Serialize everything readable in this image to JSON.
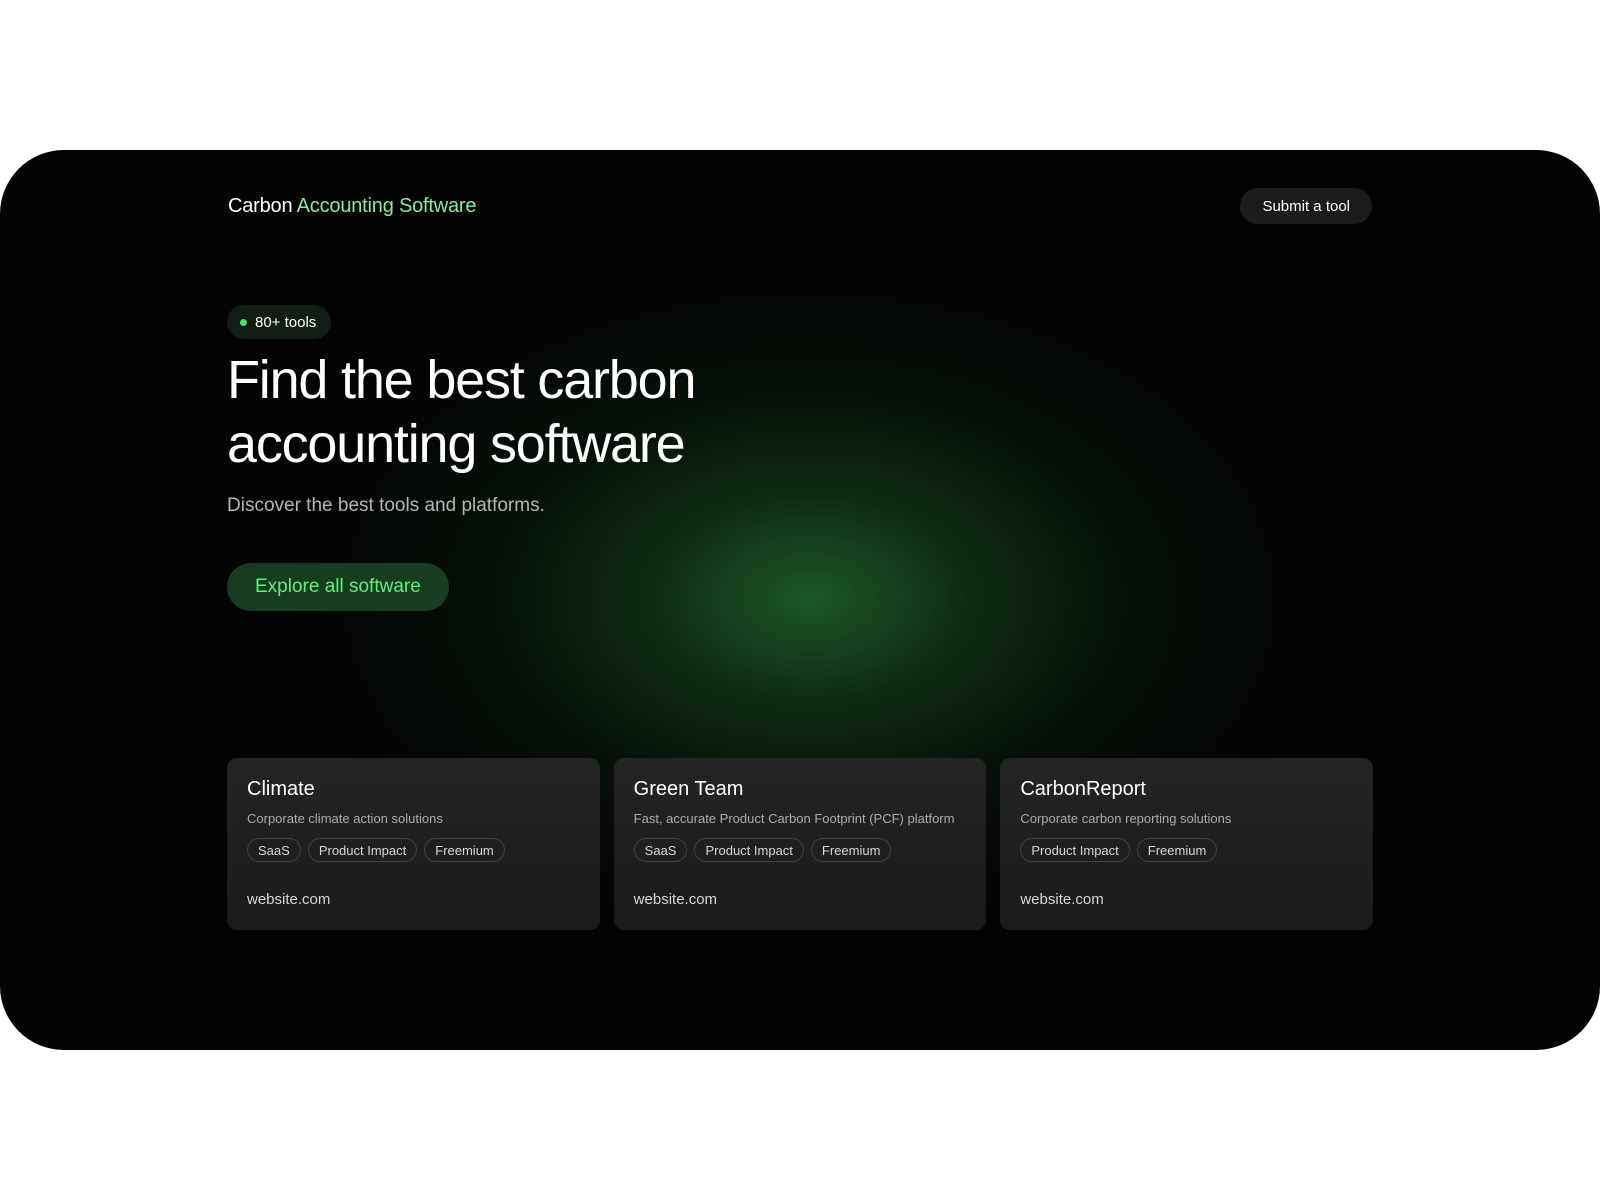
{
  "nav": {
    "logo_primary": "Carbon",
    "logo_accent": "Accounting Software",
    "submit_label": "Submit a tool"
  },
  "hero": {
    "badge_label": "80+ tools",
    "headline_line1": "Find the best carbon",
    "headline_line2": "accounting software",
    "subhead": "Discover the best tools and platforms.",
    "cta_label": "Explore all software"
  },
  "cards": [
    {
      "title": "Climate",
      "description": "Corporate climate action solutions",
      "tags": [
        "SaaS",
        "Product Impact",
        "Freemium"
      ],
      "link": "website.com"
    },
    {
      "title": "Green Team",
      "description": "Fast, accurate Product Carbon Footprint (PCF) platform",
      "tags": [
        "SaaS",
        "Product Impact",
        "Freemium"
      ],
      "link": "website.com"
    },
    {
      "title": "CarbonReport",
      "description": "Corporate carbon reporting solutions",
      "tags": [
        "Product Impact",
        "Freemium"
      ],
      "link": "website.com"
    }
  ],
  "colors": {
    "accent_green": "#8ee89c",
    "cta_text": "#5ff07c",
    "cta_bg": "#163d20",
    "background": "#030303"
  }
}
